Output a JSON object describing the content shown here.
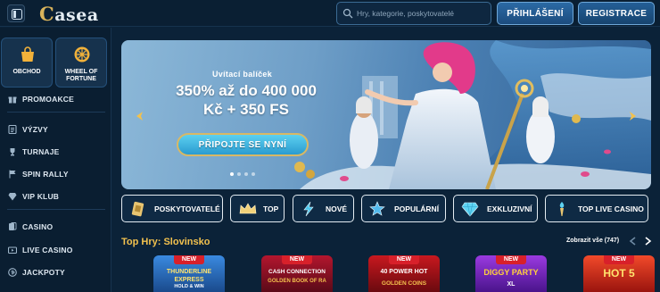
{
  "header": {
    "logo": "Casea",
    "search_placeholder": "Hry, kategorie, poskytovatelé",
    "login_label": "PŘIHLÁŠENÍ",
    "register_label": "REGISTRACE"
  },
  "sidebar": {
    "tiles": [
      {
        "label": "OBCHOD",
        "icon": "shop-bag-icon"
      },
      {
        "label": "WHEEL OF FORTUNE",
        "icon": "wheel-icon"
      }
    ],
    "items": [
      {
        "label": "PROMOAKCE",
        "icon": "gift-icon"
      },
      {
        "label": "VÝZVY",
        "icon": "checklist-icon"
      },
      {
        "label": "TURNAJE",
        "icon": "trophy-icon"
      },
      {
        "label": "SPIN RALLY",
        "icon": "flag-icon"
      },
      {
        "label": "VIP KLUB",
        "icon": "diamond-icon"
      },
      {
        "label": "CASINO",
        "icon": "cards-icon"
      },
      {
        "label": "LIVE CASINO",
        "icon": "live-icon"
      },
      {
        "label": "JACKPOTY",
        "icon": "jackpot-icon"
      }
    ]
  },
  "banner": {
    "kicker": "Uvítací balíček",
    "title_line1": "350% až do 400 000",
    "title_line2": "Kč + 350 FS",
    "cta": "PŘIPOJTE SE NYNÍ",
    "slide_count": 4,
    "active_slide": 1
  },
  "categories": [
    {
      "label": "POSKYTOVATELÉ",
      "icon": "providers-icon"
    },
    {
      "label": "TOP",
      "icon": "crown-icon"
    },
    {
      "label": "NOVÉ",
      "icon": "lightning-icon"
    },
    {
      "label": "POPULÁRNÍ",
      "icon": "star-icon"
    },
    {
      "label": "EXKLUZIVNÍ",
      "icon": "gem-icon"
    },
    {
      "label": "TOP LIVE CASINO",
      "icon": "torch-icon"
    }
  ],
  "top_games": {
    "title": "Top Hry: Slovinsko",
    "see_all": "Zobrazit vše (747)",
    "badge": "NEW",
    "games": [
      {
        "title": "THUNDERLINE EXPRESS",
        "sub": "HOLD & WIN",
        "color": "#2a73c8"
      },
      {
        "title": "CASH CONNECTION",
        "sub": "GOLDEN BOOK OF RA",
        "color": "#a2122a"
      },
      {
        "title": "40 POWER HOT",
        "sub": "GOLDEN COINS",
        "color": "#b8141c"
      },
      {
        "title": "DIGGY PARTY",
        "sub": "XL",
        "color": "#8a2ad0"
      },
      {
        "title": "HOT 5",
        "sub": "",
        "color": "#d82a1e"
      }
    ]
  },
  "colors": {
    "accent_gold": "#f2c14e",
    "background": "#0b2238",
    "button_blue": "#2b6aa5",
    "new_badge": "#d8202a"
  }
}
